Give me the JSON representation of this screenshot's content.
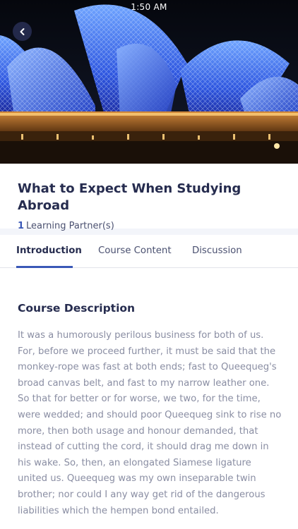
{
  "status_bar": {
    "time": "1:50 AM"
  },
  "hero": {
    "image": "sydney-opera-house-photo"
  },
  "header": {
    "back_icon": "chevron-left-icon",
    "title": "What to Expect When Studying Abroad",
    "partner_count": "1",
    "partner_label": "Learning Partner(s)"
  },
  "tabs": [
    {
      "label": "Introduction",
      "active": true
    },
    {
      "label": "Course Content",
      "active": false
    },
    {
      "label": "Discussion",
      "active": false
    }
  ],
  "course": {
    "description_title": "Course Description",
    "description": "It was a humorously perilous business for both of us. For, before we proceed further, it must be said that the monkey-rope was fast at both ends; fast to Queequeg's broad canvas belt, and fast to my narrow leather one. So that for better or for worse, we two, for the time, were wedded; and should poor Queequeg sink to rise no more, then both usage and honour demanded, that instead of cutting the cord, it should drag me down in his wake. So, then, an elongated Siamese ligature united us. Queequeg was my own inseparable twin brother; nor could I any way get rid of the dangerous liabilities which the hempen bond entailed."
  },
  "colors": {
    "accent": "#3a58b7",
    "title": "#262c4f",
    "body_text": "#8a8ea3"
  }
}
